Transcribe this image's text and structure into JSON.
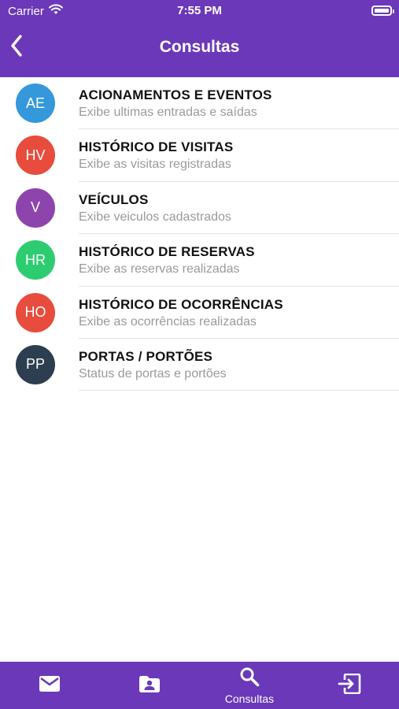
{
  "status_bar": {
    "carrier": "Carrier",
    "time": "7:55 PM"
  },
  "nav": {
    "title": "Consultas"
  },
  "items": [
    {
      "initials": "AE",
      "title": "ACIONAMENTOS E EVENTOS",
      "subtitle": "Exibe ultimas entradas e saídas",
      "color": "#3498db"
    },
    {
      "initials": "HV",
      "title": "HISTÓRICO DE VISITAS",
      "subtitle": "Exibe as visitas registradas",
      "color": "#e74c3c"
    },
    {
      "initials": "V",
      "title": "VEÍCULOS",
      "subtitle": "Exibe veiculos cadastrados",
      "color": "#8e44ad"
    },
    {
      "initials": "HR",
      "title": "HISTÓRICO DE RESERVAS",
      "subtitle": "Exibe as reservas realizadas",
      "color": "#2ecc71"
    },
    {
      "initials": "HO",
      "title": "HISTÓRICO DE OCORRÊNCIAS",
      "subtitle": "Exibe as ocorrências realizadas",
      "color": "#e74c3c"
    },
    {
      "initials": "PP",
      "title": "PORTAS / PORTÕES",
      "subtitle": "Status de portas e portões",
      "color": "#2c3e50"
    }
  ],
  "tabbar": {
    "tabs": [
      {
        "icon": "mail-icon",
        "label": ""
      },
      {
        "icon": "contact-folder-icon",
        "label": ""
      },
      {
        "icon": "search-icon",
        "label": "Consultas"
      },
      {
        "icon": "logout-icon",
        "label": ""
      }
    ]
  },
  "colors": {
    "primary": "#6a38b8",
    "separator": "#e3e3e3",
    "subtitle": "#9a9a9a"
  }
}
